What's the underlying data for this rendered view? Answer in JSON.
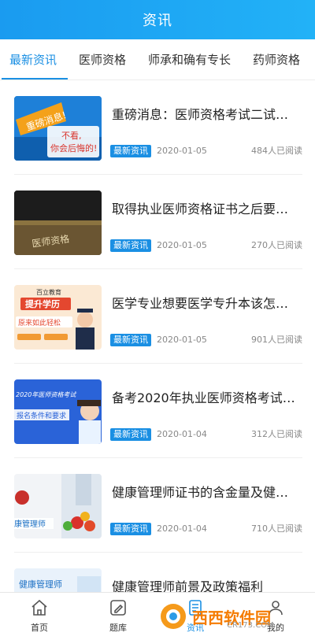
{
  "header": {
    "title": "资讯"
  },
  "tabs": [
    {
      "label": "最新资讯",
      "active": true
    },
    {
      "label": "医师资格",
      "active": false
    },
    {
      "label": "师承和确有专长",
      "active": false
    },
    {
      "label": "药师资格",
      "active": false
    }
  ],
  "articles": [
    {
      "title": "重磅消息：医师资格考试二试…",
      "tag": "最新资讯",
      "date": "2020-01-05",
      "reads": "484人已阅读",
      "thumb_text": [
        "重磅消息!",
        "不看,",
        "你会后悔的!"
      ]
    },
    {
      "title": "取得执业医师资格证书之后要…",
      "tag": "最新资讯",
      "date": "2020-01-05",
      "reads": "270人已阅读",
      "thumb_text": [
        "医师资格"
      ]
    },
    {
      "title": "医学专业想要医学专升本该怎…",
      "tag": "最新资讯",
      "date": "2020-01-05",
      "reads": "901人已阅读",
      "thumb_text": [
        "百立教育",
        "提升学历",
        "原来如此轻松"
      ]
    },
    {
      "title": "备考2020年执业医师资格考试…",
      "tag": "最新资讯",
      "date": "2020-01-04",
      "reads": "312人已阅读",
      "thumb_text": [
        "2020年医师资格考试",
        "报名条件和要求"
      ]
    },
    {
      "title": "健康管理师证书的含金量及健…",
      "tag": "最新资讯",
      "date": "2020-01-04",
      "reads": "710人已阅读",
      "thumb_text": [
        "康管理师"
      ]
    },
    {
      "title": "健康管理师前景及政策福利",
      "tag": "",
      "date": "",
      "reads": "",
      "thumb_text": [
        "健康管理师"
      ]
    }
  ],
  "bottom_nav": [
    {
      "label": "首页",
      "icon": "home-icon"
    },
    {
      "label": "题库",
      "icon": "pen-icon"
    },
    {
      "label": "资讯",
      "icon": "news-icon"
    },
    {
      "label": "我的",
      "icon": "user-icon"
    }
  ],
  "watermark": {
    "text": "西西软件园",
    "sub": "CR173.COM"
  },
  "colors": {
    "accent": "#1a8fe3",
    "header": "#1a9bf0"
  }
}
